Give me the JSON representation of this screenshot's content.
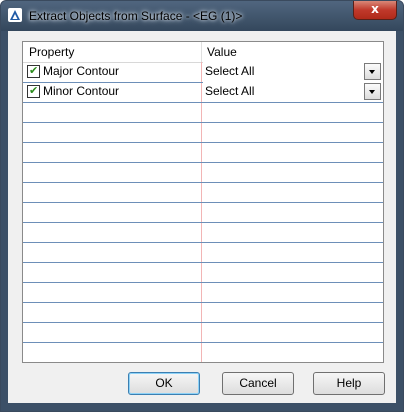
{
  "window": {
    "title": "Extract Objects from Surface - <EG (1)>",
    "close_label": "x"
  },
  "grid": {
    "headers": {
      "property": "Property",
      "value": "Value"
    },
    "rows": [
      {
        "label": "Major Contour",
        "checked": true,
        "value": "Select All"
      },
      {
        "label": "Minor Contour",
        "checked": true,
        "value": "Select All"
      }
    ],
    "check_glyph": "✔"
  },
  "buttons": {
    "ok": "OK",
    "cancel": "Cancel",
    "help": "Help"
  },
  "colors": {
    "titlebar": "#3c5067",
    "close_button": "#c0392b",
    "row_line": "#6d8fb8",
    "column_divider": "#f2b5b5",
    "check_mark": "#2a8a1a"
  }
}
